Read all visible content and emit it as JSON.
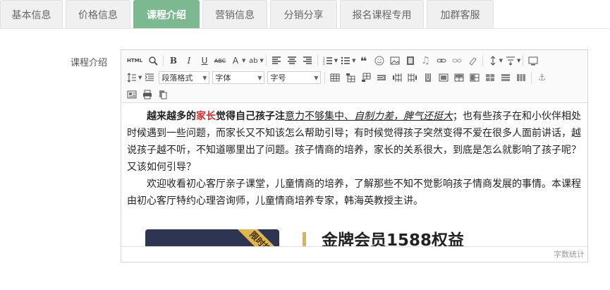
{
  "tabs": [
    {
      "label": "基本信息",
      "active": false
    },
    {
      "label": "价格信息",
      "active": false
    },
    {
      "label": "课程介绍",
      "active": true
    },
    {
      "label": "营销信息",
      "active": false
    },
    {
      "label": "分销分享",
      "active": false
    },
    {
      "label": "报名课程专用",
      "active": false
    },
    {
      "label": "加群客服",
      "active": false
    }
  ],
  "field_label": "课程介绍",
  "toolbar": {
    "html_label": "HTML",
    "paragraph_format": "段落格式",
    "font_family": "字体",
    "font_size": "字号"
  },
  "content": {
    "p1_bold": "越来越多的",
    "p1_red": "家长",
    "p1_bold2": "觉得自己孩子注",
    "p1_under": "意力不够集中、",
    "p1_italic": "自制力差，脾气还挺大",
    "p1_rest": "；也有些孩子在和小伙伴相处时候遇到一些问题，而家长又不知该怎么帮助引导；有时候觉得孩子突然变得不爱在很多人面前讲话，越说孩子越不听，不知道哪里出了问题。孩子情商的培养，家长的关系很大，到底是怎么就影响了孩子呢？又该如何引导？",
    "p2": "欢迎收看初心客厅亲子课堂，儿童情商的培养，了解那些不知不觉影响孩子情商发展的事情。本课程由初心客厅特约心理咨询师，儿童情商培养专家，韩海英教授主讲。",
    "promo_ribbon": "限时折",
    "promo_title": "金牌会员1588权益"
  },
  "statusbar": {
    "word_count": "字数统计"
  },
  "colors": {
    "active_tab": "#7cb990",
    "highlight_red": "#d92b2b",
    "gold": "#d9b35b"
  }
}
